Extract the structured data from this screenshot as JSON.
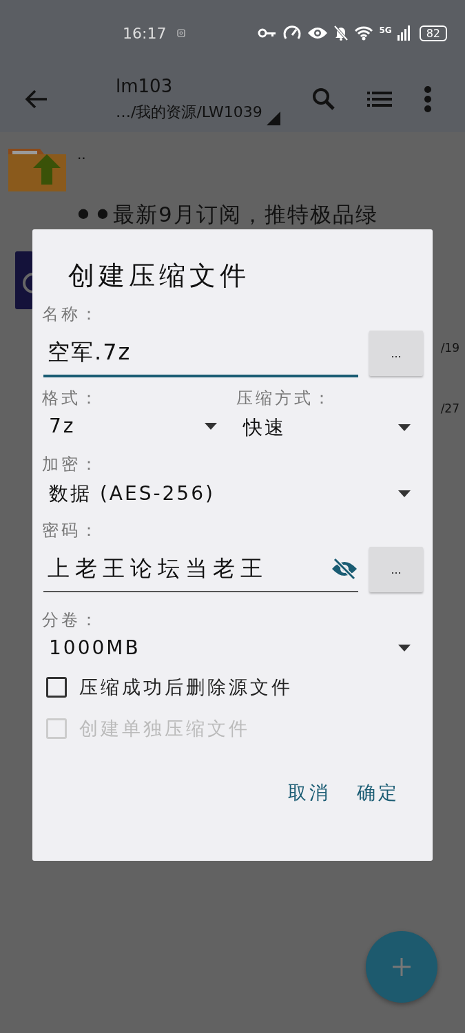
{
  "status_bar": {
    "time": "16:17",
    "network": "5G",
    "battery": "82"
  },
  "toolbar": {
    "title": "lm103",
    "subtitle": "…/我的资源/LW1039"
  },
  "file_list": [
    {
      "kind": "parent",
      "name": ".."
    },
    {
      "kind": "file",
      "name": "⚫⚫最新9月订阅，推特极品绿"
    },
    {
      "kind": "date",
      "date": "/19"
    },
    {
      "kind": "date",
      "date": "/27"
    }
  ],
  "dialog": {
    "title": "创建压缩文件",
    "name": {
      "label": "名称：",
      "value": "空军.7z",
      "browse": "..."
    },
    "format": {
      "label": "格式：",
      "value": "7z"
    },
    "method": {
      "label": "压缩方式：",
      "value": "快速"
    },
    "encryption": {
      "label": "加密：",
      "value": "数据 (AES-256)"
    },
    "password": {
      "label": "密码：",
      "value": "上老王论坛当老王",
      "visible": true,
      "browse": "..."
    },
    "split": {
      "label": "分卷：",
      "value": "1000MB"
    },
    "checkboxes": [
      {
        "label": "压缩成功后删除源文件",
        "checked": false,
        "disabled": false
      },
      {
        "label": "创建单独压缩文件",
        "checked": false,
        "disabled": true
      }
    ],
    "buttons": [
      "取消",
      "确定"
    ]
  }
}
